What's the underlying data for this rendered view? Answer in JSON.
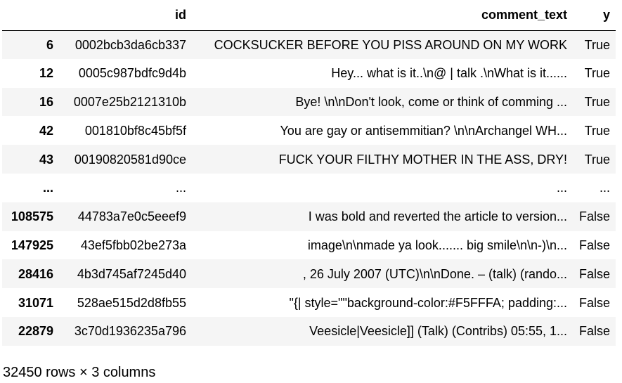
{
  "table": {
    "columns": [
      "",
      "id",
      "comment_text",
      "y"
    ],
    "rows": [
      {
        "index": "6",
        "id": "0002bcb3da6cb337",
        "comment_text": "COCKSUCKER BEFORE YOU PISS AROUND ON MY WORK",
        "y": "True"
      },
      {
        "index": "12",
        "id": "0005c987bdfc9d4b",
        "comment_text": "Hey... what is it..\\n@ | talk .\\nWhat is it......",
        "y": "True"
      },
      {
        "index": "16",
        "id": "0007e25b2121310b",
        "comment_text": "Bye! \\n\\nDon't look, come or think of comming ...",
        "y": "True"
      },
      {
        "index": "42",
        "id": "001810bf8c45bf5f",
        "comment_text": "You are gay or antisemmitian? \\n\\nArchangel WH...",
        "y": "True"
      },
      {
        "index": "43",
        "id": "00190820581d90ce",
        "comment_text": "FUCK YOUR FILTHY MOTHER IN THE ASS, DRY!",
        "y": "True"
      },
      {
        "index": "...",
        "id": "...",
        "comment_text": "...",
        "y": "..."
      },
      {
        "index": "108575",
        "id": "44783a7e0c5eeef9",
        "comment_text": "I was bold and reverted the article to version...",
        "y": "False"
      },
      {
        "index": "147925",
        "id": "43ef5fbb02be273a",
        "comment_text": "image\\n\\nmade ya look....... big smile\\n\\n-)\\n...",
        "y": "False"
      },
      {
        "index": "28416",
        "id": "4b3d745af7245d40",
        "comment_text": ", 26 July 2007 (UTC)\\n\\nDone. – (talk) (rando...",
        "y": "False"
      },
      {
        "index": "31071",
        "id": "528ae515d2d8fb55",
        "comment_text": "\"{| style=\"\"background-color:#F5FFFA; padding:...",
        "y": "False"
      },
      {
        "index": "22879",
        "id": "3c70d1936235a796",
        "comment_text": "Veesicle|Veesicle]] (Talk) (Contribs) 05:55, 1...",
        "y": "False"
      }
    ]
  },
  "footer": {
    "shape_text": "32450 rows × 3 columns"
  },
  "colors": {
    "stripe": "#f5f5f5",
    "background": "#ffffff",
    "text": "#000000"
  }
}
